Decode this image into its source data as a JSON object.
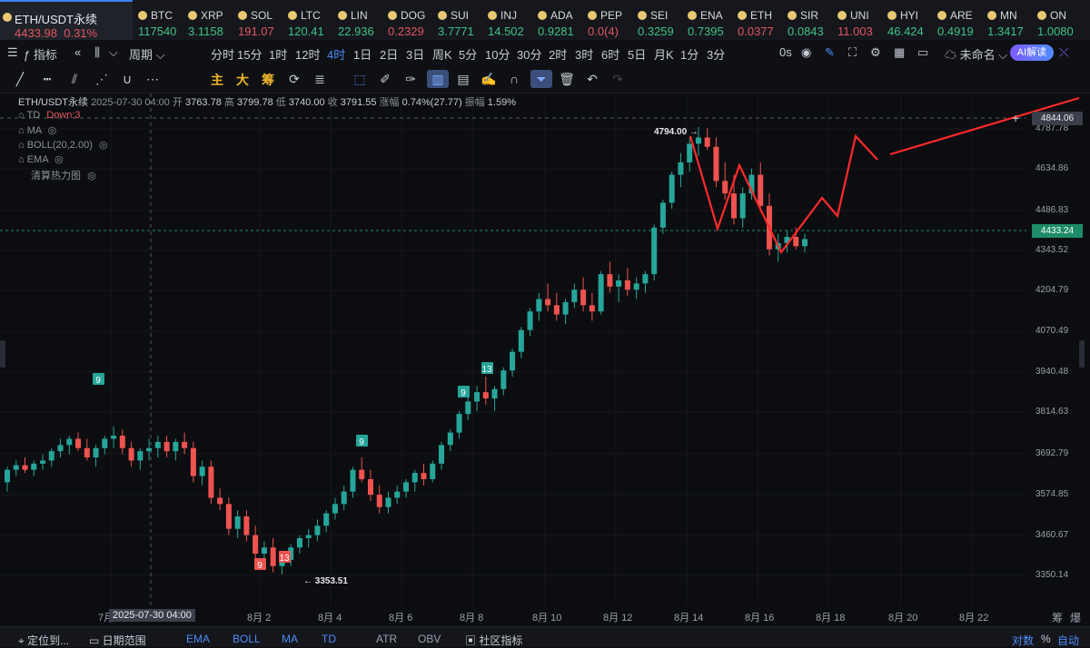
{
  "ticker": {
    "active": {
      "name": "ETH/USDT永续",
      "price": "4433.98",
      "change": "0.31%"
    },
    "items": [
      {
        "name": "BTC",
        "price": "117540",
        "color": "#3fc287"
      },
      {
        "name": "XRP",
        "price": "3.1158",
        "color": "#3fc287"
      },
      {
        "name": "SOL",
        "price": "191.07",
        "color": "#e15560"
      },
      {
        "name": "LTC",
        "price": "120.41",
        "color": "#3fc287"
      },
      {
        "name": "LIN",
        "price": "22.936",
        "color": "#3fc287"
      },
      {
        "name": "DOG",
        "price": "0.2329",
        "color": "#e15560"
      },
      {
        "name": "SUI",
        "price": "3.7771",
        "color": "#3fc287"
      },
      {
        "name": "INJ",
        "price": "14.502",
        "color": "#3fc287"
      },
      {
        "name": "ADA",
        "price": "0.9281",
        "color": "#3fc287"
      },
      {
        "name": "PEP",
        "price": "0.0(4)",
        "color": "#e15560"
      },
      {
        "name": "SEI",
        "price": "0.3259",
        "color": "#3fc287"
      },
      {
        "name": "ENA",
        "price": "0.7395",
        "color": "#3fc287"
      },
      {
        "name": "ETH",
        "price": "0.0377",
        "color": "#e15560"
      },
      {
        "name": "SIR",
        "price": "0.0843",
        "color": "#3fc287"
      },
      {
        "name": "UNI",
        "price": "11.003",
        "color": "#e15560"
      },
      {
        "name": "HYI",
        "price": "46.424",
        "color": "#3fc287"
      },
      {
        "name": "ARE",
        "price": "0.4919",
        "color": "#3fc287"
      },
      {
        "name": "MN",
        "price": "1.3417",
        "color": "#3fc287"
      },
      {
        "name": "ON",
        "price": "1.0080",
        "color": "#3fc287"
      }
    ]
  },
  "toolbar": {
    "indicator_label": "指标",
    "period_label": "周期",
    "periods": [
      "分时",
      "15分",
      "1时",
      "12时",
      "4时",
      "1日",
      "2日",
      "3日",
      "周K",
      "5分",
      "10分",
      "30分",
      "2时",
      "3时",
      "6时",
      "5日",
      "月K",
      "1分",
      "3分"
    ],
    "active_period": "4时",
    "seconds_label": "0s",
    "layout_name": "未命名",
    "ai_label": "AI解读"
  },
  "drawing_tools": {
    "labels": [
      "主",
      "大",
      "筹"
    ]
  },
  "info": {
    "symbol": "ETH/USDT永续",
    "time": "2025-07-30 04:00",
    "open_label": "开",
    "open": "3763.78",
    "high_label": "高",
    "high": "3799.78",
    "low_label": "低",
    "low": "3740.00",
    "close_label": "收",
    "close": "3791.55",
    "change_label": "涨幅",
    "change": "0.74%(27.77)",
    "amp_label": "振幅",
    "amp": "1.59%"
  },
  "indicators": {
    "td": "TD",
    "td_state": "Down:3",
    "ma": "MA",
    "boll": "BOLL(20,2.00)",
    "ema": "EMA",
    "heatmap": "清算热力图"
  },
  "price_axis": {
    "ticks": [
      "4787.78",
      "4634.86",
      "4486.83",
      "4343.52",
      "4204.79",
      "4070.49",
      "3940.48",
      "3814.63",
      "3692.79",
      "3574.85",
      "3460.67",
      "3350.14"
    ],
    "crosshair_price": "4844.06",
    "current_price": "4433.24"
  },
  "time_axis": {
    "ticks": [
      "7月",
      "8月 2",
      "8月 4",
      "8月 6",
      "8月 8",
      "8月 10",
      "8月 12",
      "8月 14",
      "8月 16",
      "8月 18",
      "8月 20",
      "8月 22"
    ],
    "crosshair_time": "2025-07-30 04:00",
    "right_labels": [
      "筹",
      "爆"
    ]
  },
  "chart_annotations": {
    "high_label": "4794.00",
    "low_label": "3353.51",
    "td_markers": [
      "9",
      "9",
      "13",
      "9",
      "9",
      "13"
    ]
  },
  "bottom_bar": {
    "locate": "定位到...",
    "date_range": "日期范围",
    "indicators": [
      "EMA",
      "BOLL",
      "MA",
      "TD",
      "ATR",
      "OBV"
    ],
    "community": "社区指标",
    "right": [
      "对数",
      "%",
      "自动"
    ]
  },
  "colors": {
    "up": "#26a69a",
    "down": "#ef5350",
    "accent": "#3b82f6",
    "arrow": "#ff2a2a"
  },
  "chart_data": {
    "type": "candlestick",
    "x_range": [
      "2025-07-28",
      "2025-08-23"
    ],
    "ylim": [
      3320,
      4880
    ],
    "candles": [
      [
        3650,
        3700,
        3620,
        3690
      ],
      [
        3690,
        3720,
        3670,
        3705
      ],
      [
        3705,
        3730,
        3680,
        3690
      ],
      [
        3690,
        3720,
        3670,
        3710
      ],
      [
        3710,
        3740,
        3690,
        3720
      ],
      [
        3720,
        3760,
        3700,
        3750
      ],
      [
        3750,
        3790,
        3730,
        3770
      ],
      [
        3770,
        3800,
        3740,
        3790
      ],
      [
        3790,
        3810,
        3750,
        3760
      ],
      [
        3760,
        3790,
        3720,
        3730
      ],
      [
        3730,
        3770,
        3700,
        3760
      ],
      [
        3760,
        3800,
        3740,
        3790
      ],
      [
        3790,
        3830,
        3760,
        3800
      ],
      [
        3800,
        3820,
        3740,
        3760
      ],
      [
        3760,
        3780,
        3700,
        3720
      ],
      [
        3720,
        3760,
        3690,
        3750
      ],
      [
        3750,
        3790,
        3720,
        3760
      ],
      [
        3760,
        3800,
        3730,
        3780
      ],
      [
        3780,
        3800,
        3730,
        3750
      ],
      [
        3750,
        3790,
        3720,
        3780
      ],
      [
        3780,
        3810,
        3740,
        3760
      ],
      [
        3760,
        3780,
        3650,
        3670
      ],
      [
        3670,
        3720,
        3640,
        3700
      ],
      [
        3700,
        3720,
        3580,
        3600
      ],
      [
        3600,
        3630,
        3560,
        3580
      ],
      [
        3580,
        3600,
        3480,
        3500
      ],
      [
        3500,
        3560,
        3470,
        3540
      ],
      [
        3540,
        3560,
        3460,
        3480
      ],
      [
        3480,
        3510,
        3400,
        3420
      ],
      [
        3420,
        3460,
        3380,
        3440
      ],
      [
        3440,
        3470,
        3360,
        3380
      ],
      [
        3380,
        3420,
        3353,
        3400
      ],
      [
        3400,
        3450,
        3380,
        3440
      ],
      [
        3440,
        3480,
        3420,
        3470
      ],
      [
        3470,
        3500,
        3440,
        3480
      ],
      [
        3480,
        3530,
        3460,
        3510
      ],
      [
        3510,
        3560,
        3490,
        3550
      ],
      [
        3550,
        3600,
        3530,
        3580
      ],
      [
        3580,
        3640,
        3560,
        3620
      ],
      [
        3620,
        3700,
        3600,
        3690
      ],
      [
        3690,
        3730,
        3650,
        3660
      ],
      [
        3660,
        3690,
        3590,
        3610
      ],
      [
        3610,
        3640,
        3550,
        3570
      ],
      [
        3570,
        3620,
        3550,
        3600
      ],
      [
        3600,
        3640,
        3580,
        3620
      ],
      [
        3620,
        3660,
        3600,
        3650
      ],
      [
        3650,
        3690,
        3620,
        3680
      ],
      [
        3680,
        3710,
        3640,
        3660
      ],
      [
        3660,
        3720,
        3650,
        3710
      ],
      [
        3710,
        3780,
        3690,
        3770
      ],
      [
        3770,
        3820,
        3750,
        3810
      ],
      [
        3810,
        3880,
        3790,
        3870
      ],
      [
        3870,
        3930,
        3850,
        3910
      ],
      [
        3910,
        3960,
        3880,
        3940
      ],
      [
        3940,
        3990,
        3900,
        3920
      ],
      [
        3920,
        3960,
        3880,
        3950
      ],
      [
        3950,
        4020,
        3930,
        4010
      ],
      [
        4010,
        4080,
        3990,
        4070
      ],
      [
        4070,
        4150,
        4050,
        4140
      ],
      [
        4140,
        4210,
        4120,
        4200
      ],
      [
        4200,
        4260,
        4170,
        4240
      ],
      [
        4240,
        4290,
        4200,
        4220
      ],
      [
        4220,
        4260,
        4170,
        4190
      ],
      [
        4190,
        4240,
        4160,
        4230
      ],
      [
        4230,
        4290,
        4210,
        4270
      ],
      [
        4270,
        4310,
        4200,
        4220
      ],
      [
        4220,
        4260,
        4170,
        4200
      ],
      [
        4200,
        4330,
        4190,
        4320
      ],
      [
        4320,
        4360,
        4260,
        4280
      ],
      [
        4280,
        4320,
        4230,
        4300
      ],
      [
        4300,
        4340,
        4250,
        4270
      ],
      [
        4270,
        4310,
        4240,
        4290
      ],
      [
        4290,
        4330,
        4260,
        4320
      ],
      [
        4320,
        4480,
        4300,
        4470
      ],
      [
        4470,
        4560,
        4450,
        4550
      ],
      [
        4550,
        4650,
        4530,
        4640
      ],
      [
        4640,
        4710,
        4600,
        4680
      ],
      [
        4680,
        4760,
        4650,
        4740
      ],
      [
        4740,
        4794,
        4700,
        4760
      ],
      [
        4760,
        4790,
        4720,
        4730
      ],
      [
        4730,
        4760,
        4600,
        4620
      ],
      [
        4620,
        4680,
        4560,
        4580
      ],
      [
        4580,
        4640,
        4480,
        4500
      ],
      [
        4500,
        4600,
        4470,
        4580
      ],
      [
        4580,
        4660,
        4560,
        4640
      ],
      [
        4640,
        4680,
        4520,
        4540
      ],
      [
        4540,
        4580,
        4380,
        4400
      ],
      [
        4400,
        4450,
        4360,
        4420
      ],
      [
        4420,
        4460,
        4390,
        4440
      ],
      [
        4440,
        4470,
        4400,
        4410
      ],
      [
        4410,
        4450,
        4390,
        4433
      ]
    ]
  }
}
